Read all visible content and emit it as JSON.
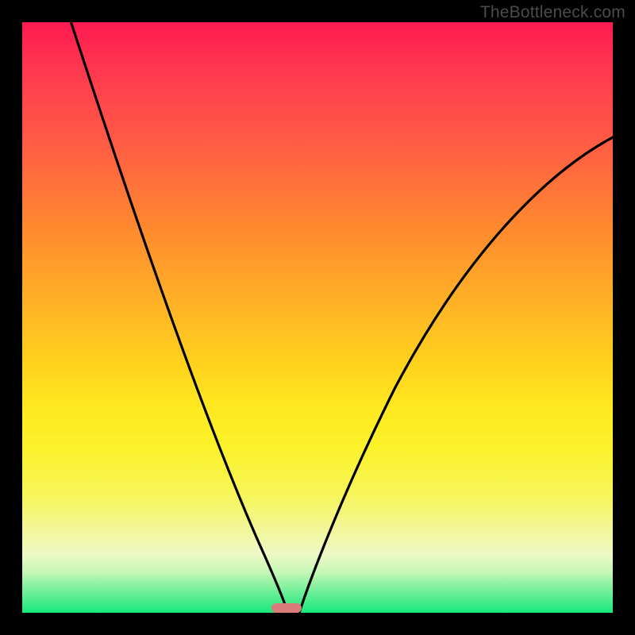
{
  "watermark": "TheBottleneck.com",
  "colors": {
    "frame_border": "#000000",
    "curve": "#000000",
    "marker": "#d97b7b",
    "gradient_top": "#ff1a50",
    "gradient_bottom": "#17e87d"
  },
  "chart_data": {
    "type": "line",
    "title": "",
    "xlabel": "",
    "ylabel": "",
    "xlim": [
      0,
      100
    ],
    "ylim": [
      0,
      100
    ],
    "grid": false,
    "legend": false,
    "annotations": [
      {
        "name": "optimal-marker",
        "x": 45,
        "y": 0,
        "width": 5,
        "color": "#d97b7b"
      }
    ],
    "series": [
      {
        "name": "left-branch",
        "description": "Steep descending curve from top-left to valley",
        "x": [
          0,
          4,
          8,
          12,
          16,
          20,
          24,
          28,
          32,
          36,
          40,
          42,
          44,
          45
        ],
        "y": [
          115,
          100,
          86,
          73,
          61,
          50,
          40,
          31,
          23,
          15,
          8,
          4,
          1,
          0
        ]
      },
      {
        "name": "right-branch",
        "description": "Rising curve from valley toward upper-right, flattening",
        "x": [
          45,
          47,
          50,
          54,
          58,
          62,
          66,
          70,
          74,
          78,
          82,
          86,
          90,
          94,
          98,
          100
        ],
        "y": [
          0,
          2,
          7,
          15,
          23,
          31,
          38,
          45,
          52,
          58,
          63,
          68,
          72,
          76,
          79,
          81
        ]
      }
    ]
  }
}
